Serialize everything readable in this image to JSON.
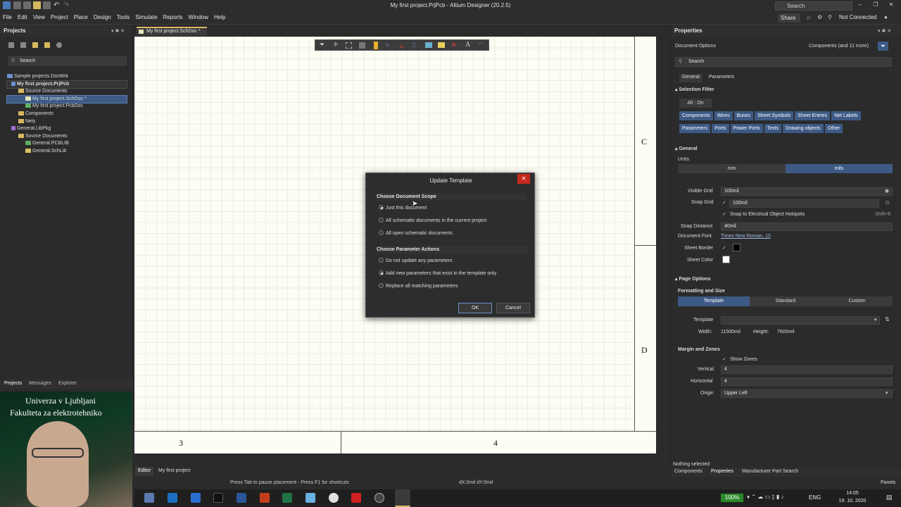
{
  "window": {
    "title": "My first project.PrjPcb - Altium Designer (20.2.5)",
    "search": "Search",
    "share": "Share",
    "connection": "Not Connected"
  },
  "menu": [
    "File",
    "Edit",
    "View",
    "Project",
    "Place",
    "Design",
    "Tools",
    "Simulate",
    "Reports",
    "Window",
    "Help"
  ],
  "projects": {
    "title": "Projects",
    "search": "Search",
    "tree": [
      "Sample projects.DsnWrk",
      "My first project.PrjPcb",
      "Source Documents",
      "My first project.SchDoc *",
      "My first project.PcbDoc",
      "Components",
      "Nets",
      "General.LibPkg",
      "Source Documents",
      "General.PCBLIB",
      "General.SchLib"
    ],
    "tabs": [
      "Projects",
      "Messages",
      "Explorer"
    ]
  },
  "doc_tab": "My first project.SchDoc *",
  "sheet": {
    "zone_c": "C",
    "zone_d": "D",
    "col3": "3",
    "col4": "4"
  },
  "dialog": {
    "title": "Update Template",
    "scope_title": "Choose Document Scope",
    "scope": [
      "Just this document",
      "All schematic documents in the current project",
      "All open schematic documents"
    ],
    "scope_selected": 0,
    "param_title": "Choose Parameter Actions",
    "params": [
      "Do not update any parameters",
      "Add new parameters that exist in the template only",
      "Replace all matching parameters"
    ],
    "param_selected": 1,
    "ok": "OK",
    "cancel": "Cancel"
  },
  "props": {
    "title": "Properties",
    "doc_options": "Document Options",
    "filter_summary": "Components (and 11 more)",
    "search": "Search",
    "tabs": [
      "General",
      "Parameters"
    ],
    "selection_filter": "Selection Filter",
    "all_on": "All - On",
    "chips": [
      "Components",
      "Wires",
      "Buses",
      "Sheet Symbols",
      "Sheet Entries",
      "Net Labels",
      "Parameters",
      "Ports",
      "Power Ports",
      "Texts",
      "Drawing objects",
      "Other"
    ],
    "general": "General",
    "units": "Units",
    "mm": "mm",
    "mils": "mils",
    "visible_grid_label": "Visible Grid",
    "visible_grid": "100mil",
    "snap_grid_label": "Snap Grid",
    "snap_grid": "100mil",
    "snap_key": "G",
    "snap_hotspots": "Snap to Electrical Object Hotspots",
    "snap_hotspots_key": "Shift+E",
    "snap_distance_label": "Snap Distance",
    "snap_distance": "40mil",
    "doc_font_label": "Document Font",
    "doc_font": "Times New Roman, 10",
    "sheet_border_label": "Sheet Border",
    "sheet_color_label": "Sheet Color",
    "page_options": "Page Options",
    "formatting": "Formatting and Size",
    "size_tabs": [
      "Template",
      "Standard",
      "Custom"
    ],
    "template_label": "Template",
    "width_label": "Width:",
    "width": "11500mil",
    "height_label": "Height:",
    "height": "7600mil",
    "margin": "Margin and Zones",
    "show_zones": "Show Zones",
    "vertical_label": "Vertical",
    "vertical": "4",
    "horizontal_label": "Horizontal",
    "horizontal": "4",
    "origin_label": "Origin",
    "origin": "Upper Left",
    "nothing_selected": "Nothing selected",
    "bottom_tabs": [
      "Components",
      "Properties",
      "Manufacturer Part Search"
    ]
  },
  "status": {
    "editor_tabs": [
      "Editor",
      "My first project"
    ],
    "hint": "Press Tab to pause placement - Press F1 for shortcuts",
    "coords": "dX:0mil dY:0mil",
    "panels": "Panels"
  },
  "webcam": {
    "line1": "Univerza v Ljubljani",
    "line2": "Fakulteta za elektrotehniko"
  },
  "tray": {
    "zoom": "100%",
    "lang": "ENG",
    "time": "14:05",
    "date": "19. 10. 2020"
  },
  "colors": {
    "accent": "#3d5a85",
    "close": "#c42b1c"
  }
}
